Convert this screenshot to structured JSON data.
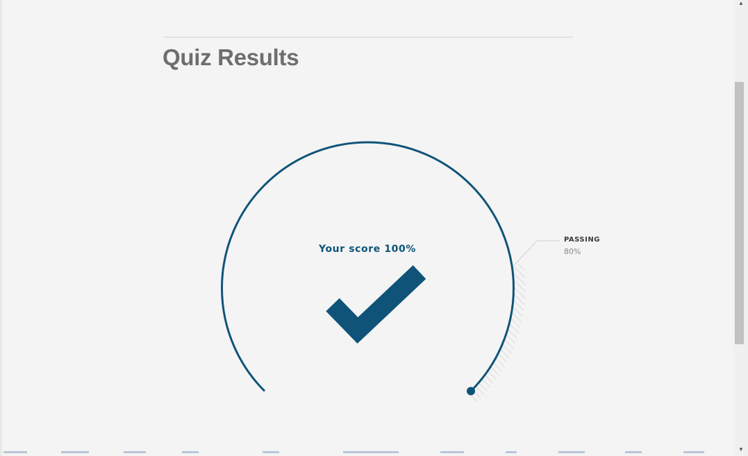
{
  "page": {
    "title": "Quiz Results"
  },
  "result": {
    "score_text": "Your score 100%",
    "score_fraction": 1.0,
    "passing_label": "PASSING",
    "passing_value": "80%",
    "passing_fraction": 0.8,
    "status_icon": "checkmark-icon"
  },
  "colors": {
    "accent": "#0f5478",
    "title": "#6e6e6e",
    "background": "#f4f4f4",
    "hatch": "#c8c8c8"
  },
  "scrollbar": {
    "up_icon": "▲",
    "down_icon": "▼"
  }
}
